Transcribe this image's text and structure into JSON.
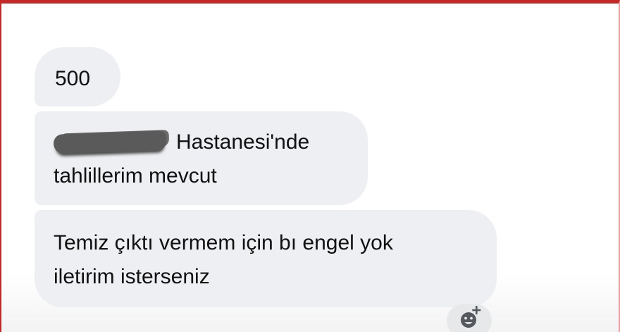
{
  "messages": [
    {
      "text": "500"
    },
    {
      "lines": [
        "Hastanesi'nde",
        "tahlillerim mevcut"
      ]
    },
    {
      "lines": [
        "Temiz çıktı vermem için bı engel yok",
        "iletirim isterseniz"
      ]
    }
  ],
  "reaction_button": {
    "icon": "add-reaction-icon"
  }
}
